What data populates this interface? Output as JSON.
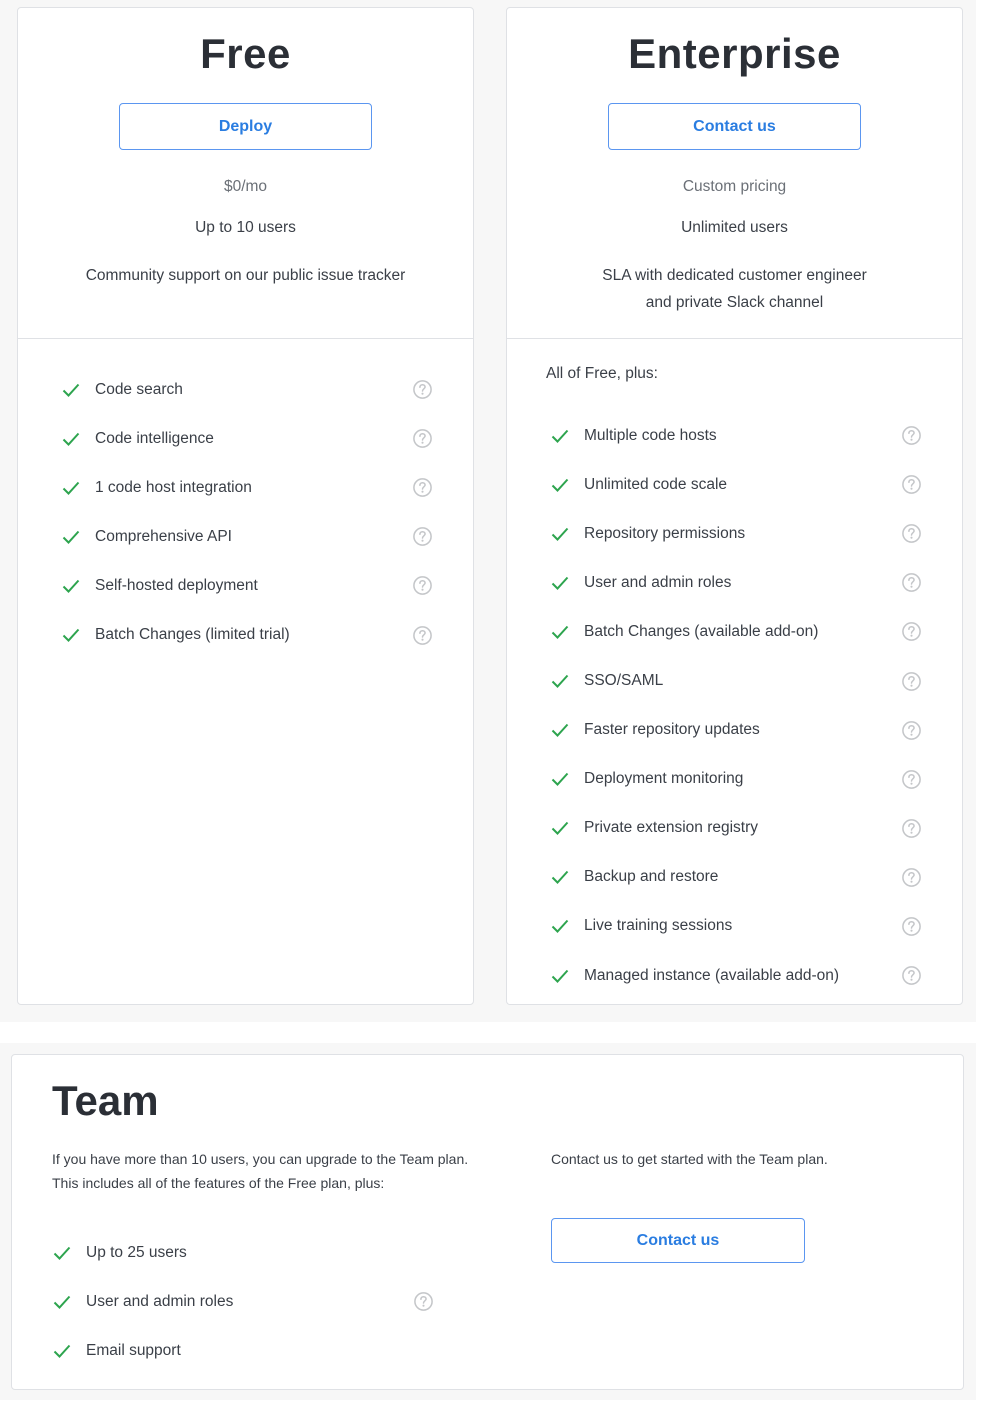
{
  "colors": {
    "accent": "#2a7de1",
    "button_border": "#5b96f0",
    "check": "#2da44e",
    "help_icon": "#c4c6c9",
    "background": "#f7f7f7"
  },
  "plans": {
    "free": {
      "title": "Free",
      "button_label": "Deploy",
      "price": "$0/mo",
      "users": "Up to 10 users",
      "support": "Community support on our public issue tracker",
      "features": [
        {
          "label": "Code search",
          "icon": "check-icon",
          "help": true
        },
        {
          "label": "Code intelligence",
          "icon": "check-icon",
          "help": true
        },
        {
          "label": "1 code host integration",
          "icon": "check-icon",
          "help": true
        },
        {
          "label": "Comprehensive API",
          "icon": "check-icon",
          "help": true
        },
        {
          "label": "Self-hosted deployment",
          "icon": "check-icon",
          "help": true
        },
        {
          "label": "Batch Changes (limited trial)",
          "icon": "check-icon",
          "help": true
        }
      ]
    },
    "enterprise": {
      "title": "Enterprise",
      "button_label": "Contact us",
      "price": "Custom pricing",
      "users": "Unlimited users",
      "support_line1": "SLA with dedicated customer engineer",
      "support_line2": "and private Slack channel",
      "intro": "All of Free, plus:",
      "features": [
        {
          "label": "Multiple code hosts",
          "icon": "check-icon",
          "help": true
        },
        {
          "label": "Unlimited code scale",
          "icon": "check-icon",
          "help": true
        },
        {
          "label": "Repository permissions",
          "icon": "check-icon",
          "help": true
        },
        {
          "label": "User and admin roles",
          "icon": "check-icon",
          "help": true
        },
        {
          "label": "Batch Changes (available add-on)",
          "icon": "check-icon",
          "help": true
        },
        {
          "label": "SSO/SAML",
          "icon": "check-icon",
          "help": true
        },
        {
          "label": "Faster repository updates",
          "icon": "check-icon",
          "help": true
        },
        {
          "label": "Deployment monitoring",
          "icon": "check-icon",
          "help": true
        },
        {
          "label": "Private extension registry",
          "icon": "check-icon",
          "help": true
        },
        {
          "label": "Backup and restore",
          "icon": "check-icon",
          "help": true
        },
        {
          "label": "Live training sessions",
          "icon": "check-icon",
          "help": true
        },
        {
          "label": "Managed instance (available add-on)",
          "icon": "check-icon",
          "help": true
        }
      ]
    },
    "team": {
      "title": "Team",
      "description": "If you have more than 10 users, you can upgrade to the Team plan. This includes all of the features of the Free plan, plus:",
      "cta_text": "Contact us to get started with the Team plan.",
      "button_label": "Contact us",
      "features": [
        {
          "label": "Up to 25 users",
          "icon": "check-icon",
          "help": false
        },
        {
          "label": "User and admin roles",
          "icon": "check-icon",
          "help": true
        },
        {
          "label": "Email support",
          "icon": "check-icon",
          "help": false
        }
      ]
    }
  }
}
